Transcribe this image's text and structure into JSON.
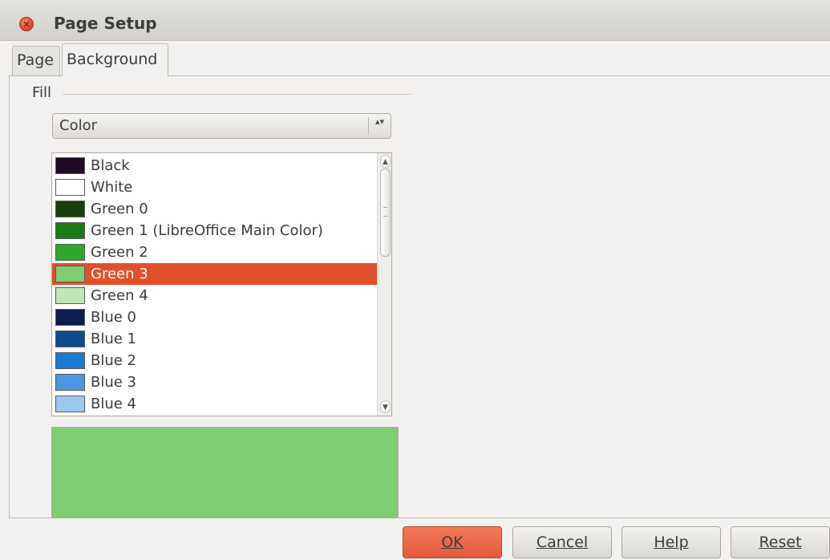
{
  "window": {
    "title": "Page Setup",
    "close_icon": "close-icon",
    "close_glyph": "×"
  },
  "tabs": [
    {
      "label": "Page",
      "active": false
    },
    {
      "label": "Background",
      "active": true
    }
  ],
  "fill": {
    "section_label": "Fill",
    "type_value": "Color",
    "type_arrows": "▴▾"
  },
  "color_list": {
    "items": [
      {
        "label": "Black",
        "color": "#1f0b25"
      },
      {
        "label": "White",
        "color": "#ffffff"
      },
      {
        "label": "Green 0",
        "color": "#1a3d10"
      },
      {
        "label": "Green 1 (LibreOffice Main Color)",
        "color": "#1a7a14"
      },
      {
        "label": "Green 2",
        "color": "#2fa82a"
      },
      {
        "label": "Green 3",
        "color": "#80cc72",
        "selected": true
      },
      {
        "label": "Green 4",
        "color": "#c0e6b8"
      },
      {
        "label": "Blue 0",
        "color": "#101b4e"
      },
      {
        "label": "Blue 1",
        "color": "#0f4a8d"
      },
      {
        "label": "Blue 2",
        "color": "#1a7ad4"
      },
      {
        "label": "Blue 3",
        "color": "#4c97e2"
      },
      {
        "label": "Blue 4",
        "color": "#9cc7ee"
      }
    ],
    "scroll_up_glyph": "▲",
    "scroll_down_glyph": "▼"
  },
  "preview": {
    "color": "#80cc72"
  },
  "buttons": {
    "ok": "OK",
    "cancel": "Cancel",
    "help": "Help",
    "reset": "Reset"
  },
  "colors": {
    "selection": "#e2502b",
    "default_button": "#e2593a"
  }
}
